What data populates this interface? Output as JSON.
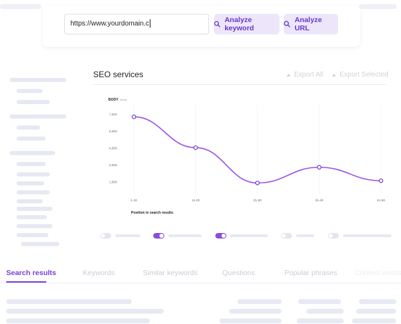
{
  "search": {
    "url_value": "https://www.yourdomain.c",
    "analyze_keyword_label": "Analyze keyword",
    "analyze_url_label": "Analyze URL",
    "search_icon": "search-icon"
  },
  "panel": {
    "title": "SEO services",
    "export_all_label": "Export All",
    "export_selected_label": "Export Selected",
    "export_icon": "cloud-upload-icon"
  },
  "chart_data": {
    "type": "line",
    "ylabel": "BODY",
    "ylabel_unit": "Words",
    "xlabel": "Position in search results",
    "categories": [
      "1-10",
      "11-20",
      "21-30",
      "31-40",
      "41-50"
    ],
    "series": [
      {
        "values": [
          7300,
          4550,
          1400,
          2800,
          1600
        ]
      }
    ],
    "yticks": [
      "7,500",
      "6,000",
      "4,500",
      "3,000",
      "1,500"
    ],
    "ylim": [
      750,
      8000
    ],
    "grid": true,
    "color": "#9a52e6"
  },
  "tabs": {
    "items": [
      "Search results",
      "Keywords",
      "Similar keywords",
      "Questions",
      "Popular phrases",
      "Content words"
    ],
    "active_index": 0
  },
  "colors": {
    "accent": "#7a3fd8",
    "button_bg": "#ede6fb",
    "line": "#9a52e6"
  }
}
